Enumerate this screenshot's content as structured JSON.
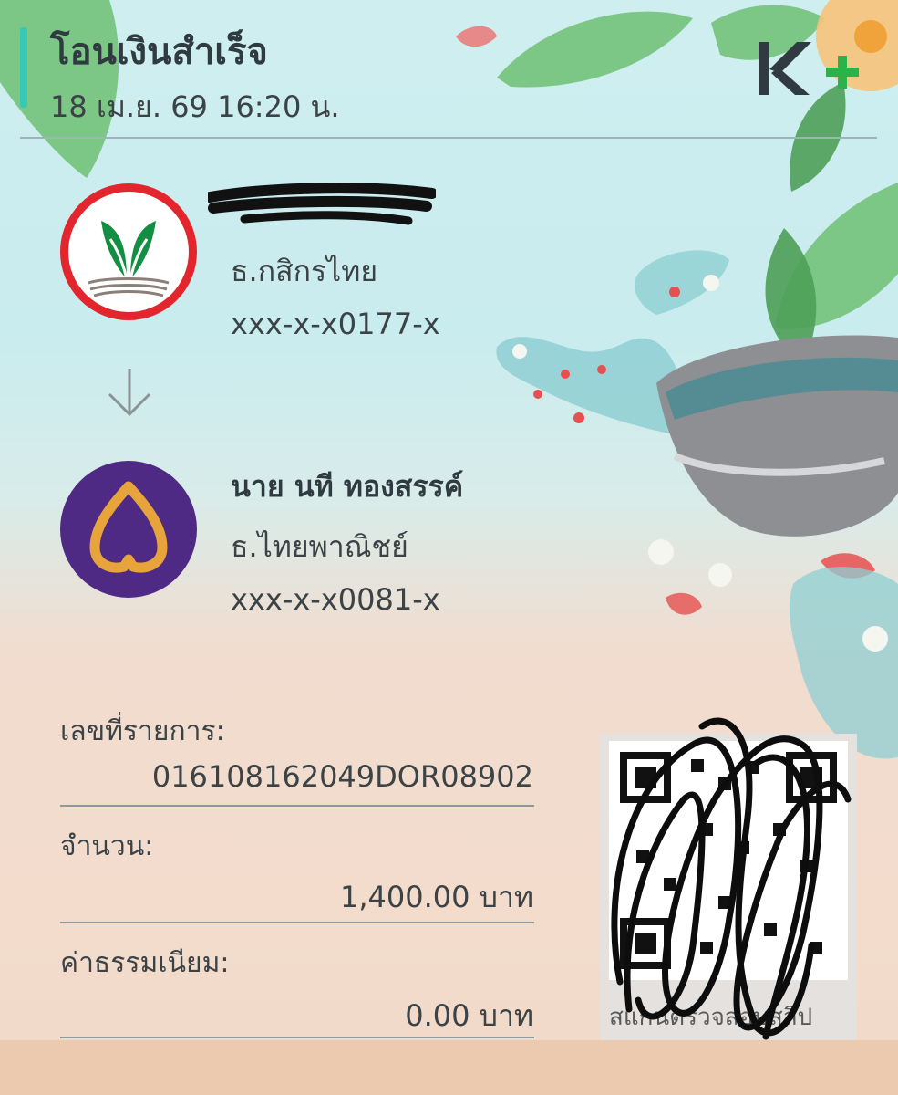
{
  "header": {
    "title": "โอนเงินสำเร็จ",
    "datetime": "18 เม.ย. 69  16:20 น.",
    "brand_logo": "K+",
    "accent_color": "#36c9b7"
  },
  "sender": {
    "bank": "ธ.กสิกรไทย",
    "account": "xxx-x-x0177-x",
    "logo_icon": "kbank-logo-icon",
    "logo_color": "#e3262d"
  },
  "transfer_arrow": "arrow-down-icon",
  "receiver": {
    "name": "นาย นที ทองสรรค์",
    "bank": "ธ.ไทยพาณิชย์",
    "account": "xxx-x-x0081-x",
    "logo_icon": "scb-logo-icon",
    "logo_color": "#4e2a84"
  },
  "details": {
    "reference_label": "เลขที่รายการ:",
    "reference_value": "016108162049DOR08902",
    "amount_label": "จำนวน:",
    "amount_value": "1,400.00 บาท",
    "fee_label": "ค่าธรรมเนียม:",
    "fee_value": "0.00 บาท"
  },
  "qr": {
    "caption": "สแกนตรวจสอบสลิป",
    "icon": "qr-code-icon"
  }
}
